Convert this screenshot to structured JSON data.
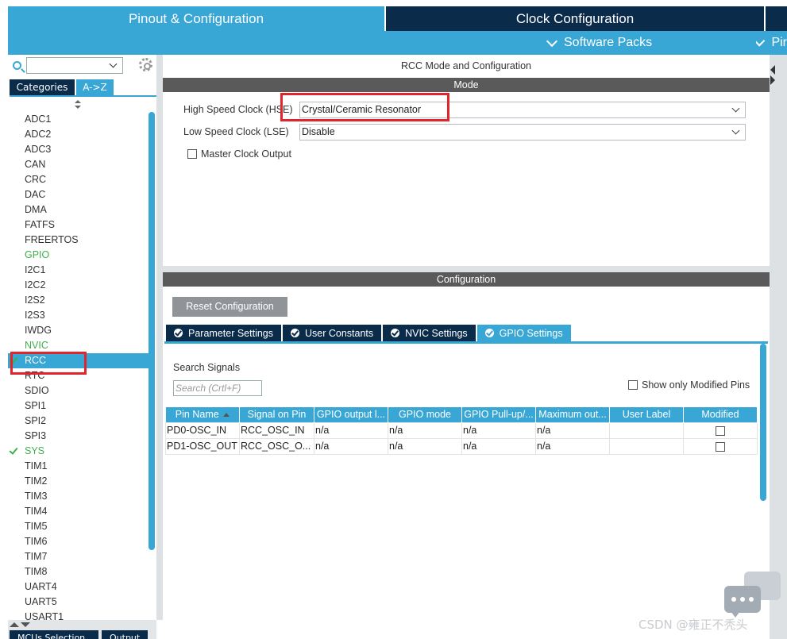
{
  "header": {
    "tabs": [
      {
        "label": "Pinout & Configuration",
        "active": true
      },
      {
        "label": "Clock Configuration",
        "active": false
      }
    ],
    "sub_items": [
      {
        "label": "Software Packs"
      },
      {
        "label": "Pir"
      }
    ]
  },
  "left_panel": {
    "category_tabs": [
      {
        "label": "Categories"
      },
      {
        "label": "A->Z"
      }
    ],
    "peripherals": [
      {
        "label": "ADC1",
        "status": "normal"
      },
      {
        "label": "ADC2",
        "status": "normal"
      },
      {
        "label": "ADC3",
        "status": "normal"
      },
      {
        "label": "CAN",
        "status": "normal"
      },
      {
        "label": "CRC",
        "status": "normal"
      },
      {
        "label": "DAC",
        "status": "normal"
      },
      {
        "label": "DMA",
        "status": "normal"
      },
      {
        "label": "FATFS",
        "status": "normal"
      },
      {
        "label": "FREERTOS",
        "status": "normal"
      },
      {
        "label": "GPIO",
        "status": "green"
      },
      {
        "label": "I2C1",
        "status": "normal"
      },
      {
        "label": "I2C2",
        "status": "normal"
      },
      {
        "label": "I2S2",
        "status": "normal"
      },
      {
        "label": "I2S3",
        "status": "normal"
      },
      {
        "label": "IWDG",
        "status": "normal"
      },
      {
        "label": "NVIC",
        "status": "green"
      },
      {
        "label": "RCC",
        "status": "selected"
      },
      {
        "label": "RTC",
        "status": "normal"
      },
      {
        "label": "SDIO",
        "status": "normal"
      },
      {
        "label": "SPI1",
        "status": "normal"
      },
      {
        "label": "SPI2",
        "status": "normal"
      },
      {
        "label": "SPI3",
        "status": "normal"
      },
      {
        "label": "SYS",
        "status": "checked"
      },
      {
        "label": "TIM1",
        "status": "normal"
      },
      {
        "label": "TIM2",
        "status": "normal"
      },
      {
        "label": "TIM3",
        "status": "normal"
      },
      {
        "label": "TIM4",
        "status": "normal"
      },
      {
        "label": "TIM5",
        "status": "normal"
      },
      {
        "label": "TIM6",
        "status": "normal"
      },
      {
        "label": "TIM7",
        "status": "normal"
      },
      {
        "label": "TIM8",
        "status": "normal"
      },
      {
        "label": "UART4",
        "status": "normal"
      },
      {
        "label": "UART5",
        "status": "normal"
      },
      {
        "label": "USART1",
        "status": "normal"
      }
    ],
    "bottom_tabs": [
      {
        "label": "MCUs Selection"
      },
      {
        "label": "Output"
      }
    ]
  },
  "mode_panel": {
    "title": "RCC Mode and Configuration",
    "section_label": "Mode",
    "hse": {
      "label": "High Speed Clock (HSE)",
      "value": "Crystal/Ceramic Resonator"
    },
    "lse": {
      "label": "Low Speed Clock (LSE)",
      "value": "Disable"
    },
    "mco": {
      "label": "Master Clock Output",
      "checked": false
    }
  },
  "config_panel": {
    "section_label": "Configuration",
    "reset_label": "Reset Configuration",
    "tabs": [
      {
        "label": "Parameter Settings",
        "active": false
      },
      {
        "label": "User Constants",
        "active": false
      },
      {
        "label": "NVIC Settings",
        "active": false
      },
      {
        "label": "GPIO Settings",
        "active": true
      }
    ],
    "search_label": "Search Signals",
    "search_placeholder": "Search (Crtl+F)",
    "show_modified_label": "Show only Modified Pins",
    "table": {
      "columns": [
        "Pin Name",
        "Signal on Pin",
        "GPIO output l...",
        "GPIO mode",
        "GPIO Pull-up/...",
        "Maximum out...",
        "User Label",
        "Modified"
      ],
      "rows": [
        [
          "PD0-OSC_IN",
          "RCC_OSC_IN",
          "n/a",
          "n/a",
          "n/a",
          "n/a",
          "",
          ""
        ],
        [
          "PD1-OSC_OUT",
          "RCC_OSC_O...",
          "n/a",
          "n/a",
          "n/a",
          "n/a",
          "",
          ""
        ]
      ]
    }
  },
  "watermark": "CSDN @雍正不秃头",
  "colors": {
    "accent": "#39a7d6",
    "dark": "#0b2b4b",
    "highlight": "#e0252b",
    "active_green": "#3db04b"
  }
}
